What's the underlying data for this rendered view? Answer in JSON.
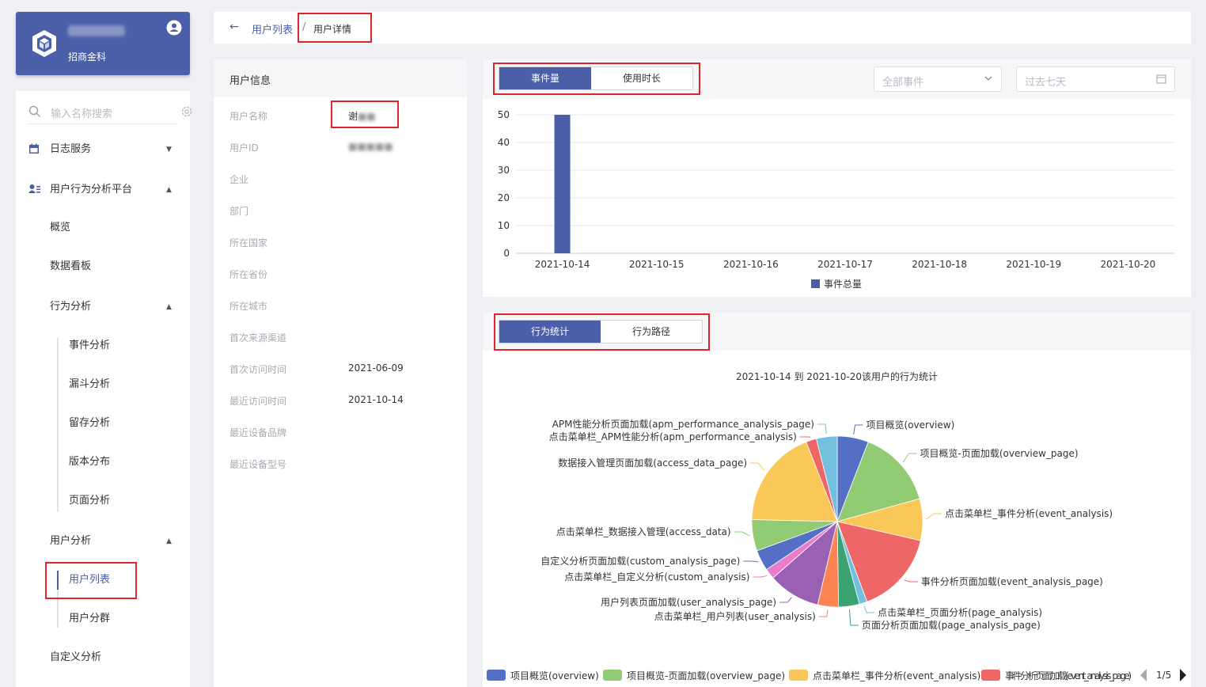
{
  "sidebar": {
    "user": {
      "org": "招商金科"
    },
    "search": {
      "placeholder": "输入名称搜索"
    },
    "items": [
      {
        "label": "日志服务"
      },
      {
        "label": "用户行为分析平台"
      },
      {
        "label": "概览"
      },
      {
        "label": "数据看板"
      },
      {
        "label": "行为分析"
      },
      {
        "label": "事件分析"
      },
      {
        "label": "漏斗分析"
      },
      {
        "label": "留存分析"
      },
      {
        "label": "版本分布"
      },
      {
        "label": "页面分析"
      },
      {
        "label": "用户分析"
      },
      {
        "label": "用户列表"
      },
      {
        "label": "用户分群"
      },
      {
        "label": "自定义分析"
      }
    ]
  },
  "breadcrumb": {
    "back": "用户列表",
    "sep": "/",
    "current": "用户详情"
  },
  "info": {
    "title": "用户信息",
    "rows": [
      {
        "key": "用户名称",
        "value": "谢"
      },
      {
        "key": "用户ID",
        "value": ""
      },
      {
        "key": "企业",
        "value": ""
      },
      {
        "key": "部门",
        "value": ""
      },
      {
        "key": "所在国家",
        "value": ""
      },
      {
        "key": "所在省份",
        "value": ""
      },
      {
        "key": "所在城市",
        "value": ""
      },
      {
        "key": "首次来源渠道",
        "value": ""
      },
      {
        "key": "首次访问时间",
        "value": "2021-06-09"
      },
      {
        "key": "最近访问时间",
        "value": "2021-10-14"
      },
      {
        "key": "最近设备品牌",
        "value": ""
      },
      {
        "key": "最近设备型号",
        "value": ""
      }
    ]
  },
  "event_card": {
    "tabs": [
      "事件量",
      "使用时长"
    ],
    "event_select": "全部事件",
    "date_range": "过去七天"
  },
  "behavior_card": {
    "tabs": [
      "行为统计",
      "行为路径"
    ],
    "pager": "1/5"
  },
  "colors": {
    "primary": "#4a5fa8",
    "highlight": "#e0242e"
  },
  "chart_data": [
    {
      "type": "bar",
      "categories": [
        "2021-10-14",
        "2021-10-15",
        "2021-10-16",
        "2021-10-17",
        "2021-10-18",
        "2021-10-19",
        "2021-10-20"
      ],
      "series": [
        {
          "name": "事件总量",
          "values": [
            50,
            0,
            0,
            0,
            0,
            0,
            0
          ]
        }
      ],
      "ylim": [
        0,
        50
      ],
      "yticks": [
        0,
        10,
        20,
        30,
        40,
        50
      ],
      "grid": true,
      "legend": "bottom"
    },
    {
      "type": "pie",
      "title": "2021-10-14 到 2021-10-20该用户的行为统计",
      "slices": [
        {
          "name": "项目概览(overview)",
          "value": 6,
          "color": "#5470c6"
        },
        {
          "name": "项目概览-页面加载(overview_page)",
          "value": 15,
          "color": "#91cc75"
        },
        {
          "name": "点击菜单栏_事件分析(event_analysis)",
          "value": 8,
          "color": "#fac858"
        },
        {
          "name": "事件分析页面加载(event_analysis_page)",
          "value": 16,
          "color": "#ee6666"
        },
        {
          "name": "点击菜单栏_页面分析(page_analysis)",
          "value": 1.5,
          "color": "#73c0de"
        },
        {
          "name": "页面分析页面加载(page_analysis_page)",
          "value": 4,
          "color": "#3ba272"
        },
        {
          "name": "点击菜单栏_用户列表(user_analysis)",
          "value": 4,
          "color": "#fc8452"
        },
        {
          "name": "用户列表页面加载(user_analysis_page)",
          "value": 10,
          "color": "#9a60b4"
        },
        {
          "name": "点击菜单栏_自定义分析(custom_analysis)",
          "value": 2,
          "color": "#ea7ccc"
        },
        {
          "name": "自定义分析页面加载(custom_analysis_page)",
          "value": 4,
          "color": "#5470c6"
        },
        {
          "name": "点击菜单栏_数据接入管理(access_data)",
          "value": 6,
          "color": "#91cc75"
        },
        {
          "name": "数据接入管理页面加载(access_data_page)",
          "value": 19,
          "color": "#fac858"
        },
        {
          "name": "点击菜单栏_APM性能分析(apm_performance_analysis)",
          "value": 2,
          "color": "#ee6666"
        },
        {
          "name": "APM性能分析页面加载(apm_performance_analysis_page)",
          "value": 4,
          "color": "#73c0de"
        }
      ],
      "legend_visible": [
        "项目概览(overview)",
        "项目概览-页面加载(overview_page)",
        "点击菜单栏_事件分析(event_analysis)",
        "事件分析页面加载(event_analysis_page)"
      ]
    }
  ]
}
